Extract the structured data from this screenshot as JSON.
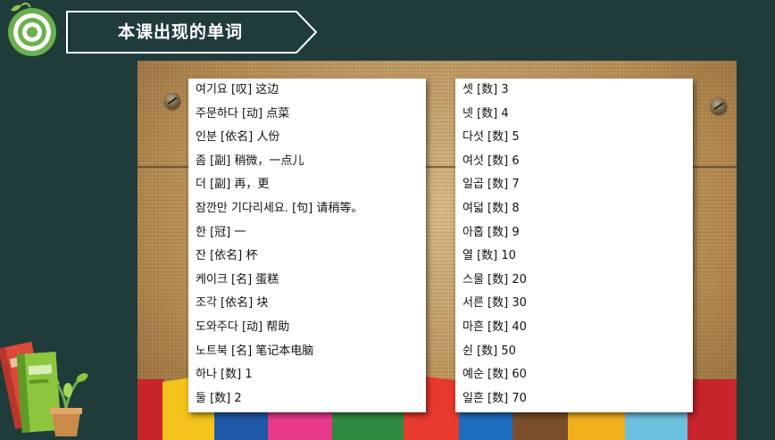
{
  "header": {
    "title": "本课出现的单词",
    "logo_icon": "target-icon",
    "accent_color": "#6ab04c"
  },
  "word_lists": {
    "left": [
      "여기요 [叹] 这边",
      "주문하다 [动] 点菜",
      "인분 [依名] 人份",
      "좀 [副] 稍微，一点儿",
      "더 [副] 再，更",
      "잠깐만 기다리세요. [句] 请稍等。",
      "한 [冠] 一",
      "잔 [依名] 杯",
      "케이크 [名] 蛋糕",
      "조각 [依名] 块",
      "도와주다 [动] 帮助",
      "노트북 [名] 笔记本电脑",
      "하나 [数] 1",
      "둘 [数] 2"
    ],
    "right": [
      "셋 [数] 3",
      "넷 [数] 4",
      "다섯 [数] 5",
      "여섯 [数] 6",
      "일곱 [数] 7",
      "여덟 [数] 8",
      "아홉 [数] 9",
      "열 [数] 10",
      "스물 [数] 20",
      "서른 [数] 30",
      "마흔 [数] 40",
      "쉰 [数] 50",
      "예순 [数] 60",
      "일흔 [数] 70"
    ]
  },
  "decor": {
    "books_icon": "books-with-plant-icon",
    "strip_colors": [
      "#c8242b",
      "#f2c31a",
      "#2058a8",
      "#e83a8a",
      "#2e8a3e",
      "#e8392e",
      "#1e6fc0",
      "#7a4e2a",
      "#f2b01c",
      "#6cc0e0"
    ]
  }
}
